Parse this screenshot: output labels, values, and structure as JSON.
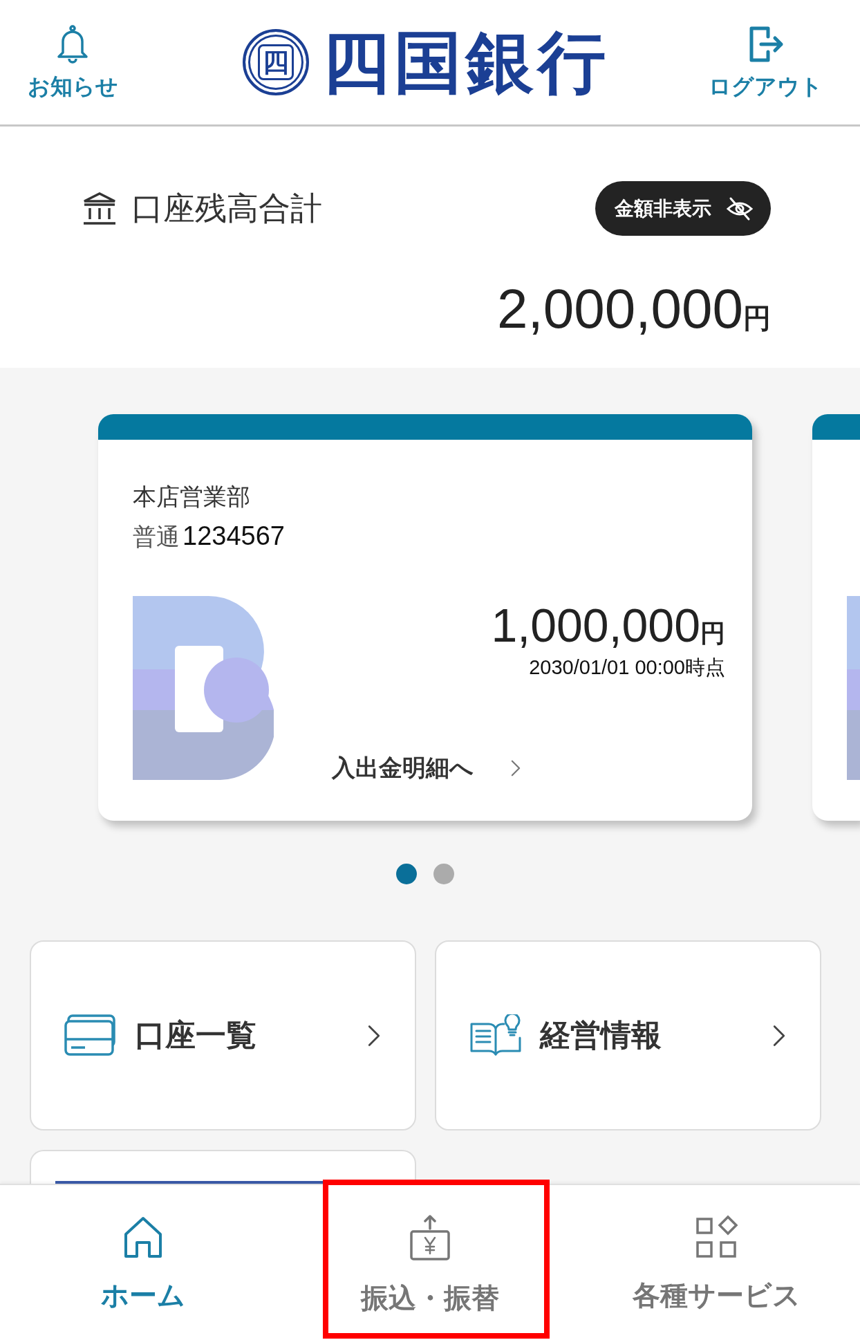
{
  "header": {
    "notice": {
      "label": "お知らせ"
    },
    "logo": {
      "emblem": "四",
      "name": "四国銀行"
    },
    "logout": {
      "label": "ログアウト"
    }
  },
  "balance": {
    "title": "口座残高合計",
    "hide_button": {
      "label": "金額非表示"
    },
    "total": "2,000,000",
    "unit": "円"
  },
  "accounts": [
    {
      "kind": "full",
      "branch": "本店営業部",
      "type": "普通",
      "number": "1234567",
      "amount": "1,000,000",
      "unit": "円",
      "as_of": "2030/01/01 00:00時点",
      "link": "入出金明細へ"
    },
    {
      "kind": "peek"
    }
  ],
  "pager": [
    {
      "selected": true
    },
    {
      "selected": false
    }
  ],
  "menu": [
    {
      "kind": "accounts",
      "label": "口座一覧"
    },
    {
      "kind": "info",
      "label": "経営情報"
    },
    {
      "kind": "banner"
    }
  ],
  "nav": [
    {
      "kind": "home",
      "label": "ホーム",
      "selected": true,
      "highlighted": false
    },
    {
      "kind": "transfer",
      "label": "振込・振替",
      "selected": false,
      "highlighted": true
    },
    {
      "kind": "services",
      "label": "各種サービス",
      "selected": false,
      "highlighted": false
    }
  ]
}
